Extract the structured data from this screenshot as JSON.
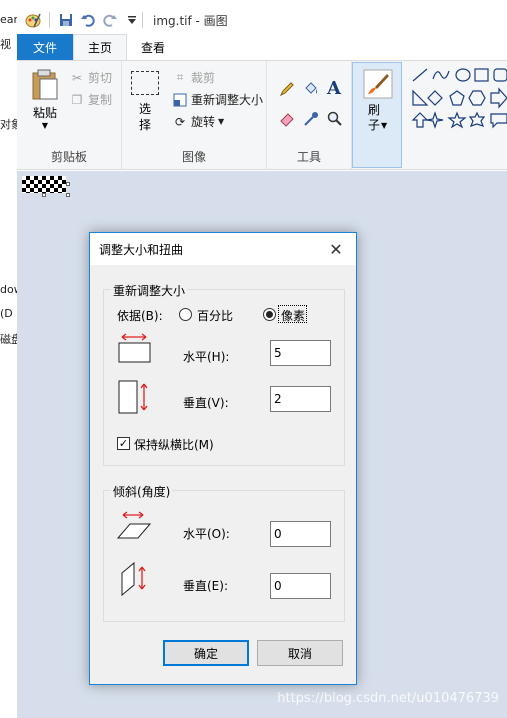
{
  "background": {
    "left_texts": [
      "ear",
      "视",
      "对象",
      "dow",
      "(D",
      "磁盘"
    ]
  },
  "window": {
    "title": "img.tif - 画图"
  },
  "tabs": {
    "file": "文件",
    "home": "主页",
    "view": "查看"
  },
  "ribbon": {
    "clipboard": {
      "paste": "粘贴",
      "cut": "剪切",
      "copy": "复制",
      "label": "剪贴板"
    },
    "image": {
      "select": "选\n择",
      "crop": "裁剪",
      "resize": "重新调整大小",
      "rotate": "旋转",
      "label": "图像"
    },
    "tools": {
      "label": "工具"
    },
    "brushes": {
      "label": "刷\n子"
    }
  },
  "dialog": {
    "title": "调整大小和扭曲",
    "resize_group": {
      "legend": "重新调整大小",
      "by_label": "依据(B):",
      "percent": "百分比",
      "pixels": "像素",
      "selected": "pixels",
      "horizontal_label": "水平(H):",
      "horizontal_value": "5",
      "vertical_label": "垂直(V):",
      "vertical_value": "2",
      "keep_ratio": "保持纵横比(M)",
      "keep_ratio_checked": true
    },
    "skew_group": {
      "legend": "倾斜(角度)",
      "horizontal_label": "水平(O):",
      "horizontal_value": "0",
      "vertical_label": "垂直(E):",
      "vertical_value": "0"
    },
    "ok": "确定",
    "cancel": "取消"
  },
  "watermark": "https://blog.csdn.net/u010476739",
  "colors": {
    "accent": "#1979ca",
    "canvas_bg": "#d5deea",
    "arrow_red": "#e02020"
  }
}
